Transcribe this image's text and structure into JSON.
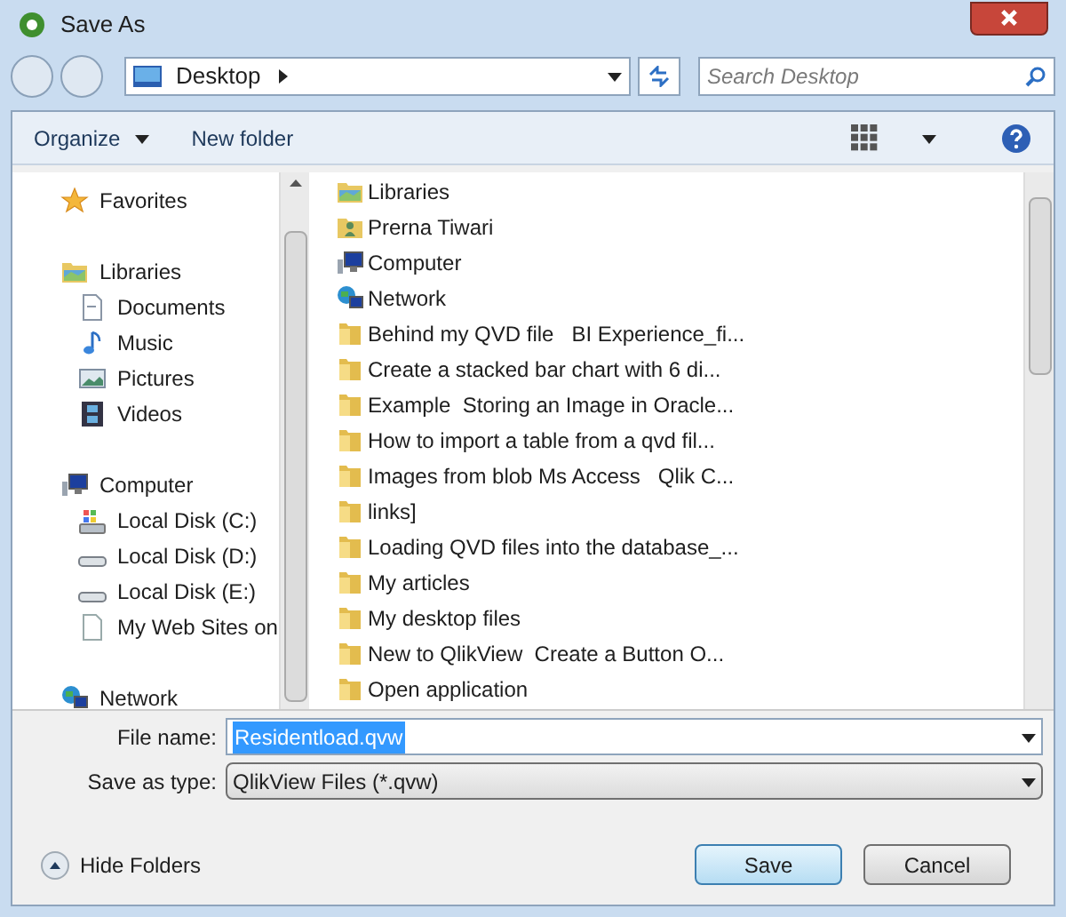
{
  "window": {
    "title": "Save As"
  },
  "address": {
    "location": "Desktop",
    "search_placeholder": "Search Desktop"
  },
  "toolbar": {
    "organize": "Organize",
    "new_folder": "New folder"
  },
  "sidebar": {
    "items": [
      {
        "label": "Favorites",
        "kind": "star"
      },
      {
        "label": "Libraries",
        "kind": "library",
        "children": [
          {
            "label": "Documents",
            "kind": "doc"
          },
          {
            "label": "Music",
            "kind": "music"
          },
          {
            "label": "Pictures",
            "kind": "picture"
          },
          {
            "label": "Videos",
            "kind": "video"
          }
        ]
      },
      {
        "label": "Computer",
        "kind": "computer",
        "children": [
          {
            "label": "Local Disk (C:)",
            "kind": "system-disk"
          },
          {
            "label": "Local Disk (D:)",
            "kind": "disk"
          },
          {
            "label": "Local Disk (E:)",
            "kind": "disk"
          },
          {
            "label": "My Web Sites on",
            "kind": "page"
          }
        ]
      },
      {
        "label": "Network",
        "kind": "network"
      }
    ]
  },
  "files": [
    {
      "label": "Libraries",
      "kind": "library"
    },
    {
      "label": "Prerna Tiwari",
      "kind": "user"
    },
    {
      "label": "Computer",
      "kind": "computer"
    },
    {
      "label": "Network",
      "kind": "network"
    },
    {
      "label": "Behind my QVD file   BI Experience_fi...",
      "kind": "folder"
    },
    {
      "label": "Create a stacked bar chart with 6 di...",
      "kind": "folder"
    },
    {
      "label": "Example  Storing an Image in Oracle...",
      "kind": "folder"
    },
    {
      "label": "How to import a table from a qvd fil...",
      "kind": "folder"
    },
    {
      "label": "Images from blob Ms Access   Qlik C...",
      "kind": "folder"
    },
    {
      "label": "links]",
      "kind": "folder"
    },
    {
      "label": "Loading QVD files into the database_...",
      "kind": "folder"
    },
    {
      "label": "My articles",
      "kind": "folder"
    },
    {
      "label": "My desktop files",
      "kind": "folder"
    },
    {
      "label": "New to QlikView  Create a Button O...",
      "kind": "folder"
    },
    {
      "label": "Open application",
      "kind": "folder"
    }
  ],
  "form": {
    "file_name_label": "File name:",
    "file_name": "Residentload.qvw",
    "type_label": "Save as type:",
    "type": "QlikView Files (*.qvw)"
  },
  "footer": {
    "hide_folders": "Hide Folders",
    "save": "Save",
    "cancel": "Cancel"
  }
}
